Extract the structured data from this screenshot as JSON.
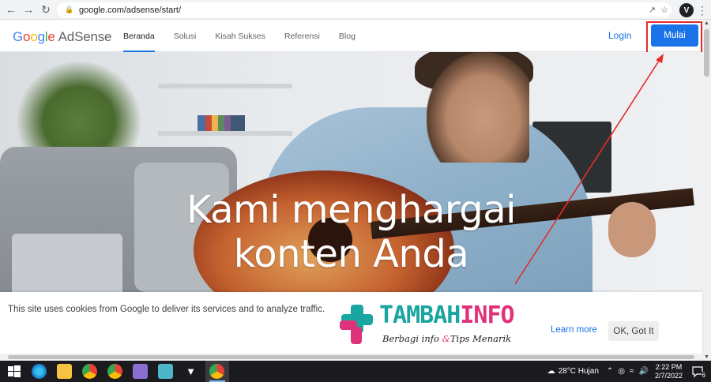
{
  "browser": {
    "url": "google.com/adsense/start/",
    "profile_initial": "V"
  },
  "header": {
    "logo_google": "Google",
    "logo_product": "AdSense",
    "nav": [
      "Beranda",
      "Solusi",
      "Kisah Sukses",
      "Referensi",
      "Blog"
    ],
    "active_nav": "Beranda",
    "login_label": "Login",
    "start_label": "Mulai"
  },
  "hero": {
    "title_line1": "Kami menghargai",
    "title_line2": "konten Anda"
  },
  "cookie": {
    "text": "This site uses cookies from Google to deliver its services and to analyze traffic.",
    "learn_more": "Learn more",
    "ok": "OK, Got It"
  },
  "watermark": {
    "title_part1": "TAMBAH",
    "title_part2": "INFO",
    "subtitle_part1": "Berbagi info ",
    "subtitle_amp": "&",
    "subtitle_part2": "Tips Menarik"
  },
  "taskbar": {
    "weather": "28°C  Hujan",
    "time": "2:22 PM",
    "date": "2/7/2022",
    "notifications": "6"
  },
  "colors": {
    "accent_blue": "#1a73e8",
    "highlight_red": "#e52b2b",
    "taskbar_bg": "#1b1b1f"
  }
}
